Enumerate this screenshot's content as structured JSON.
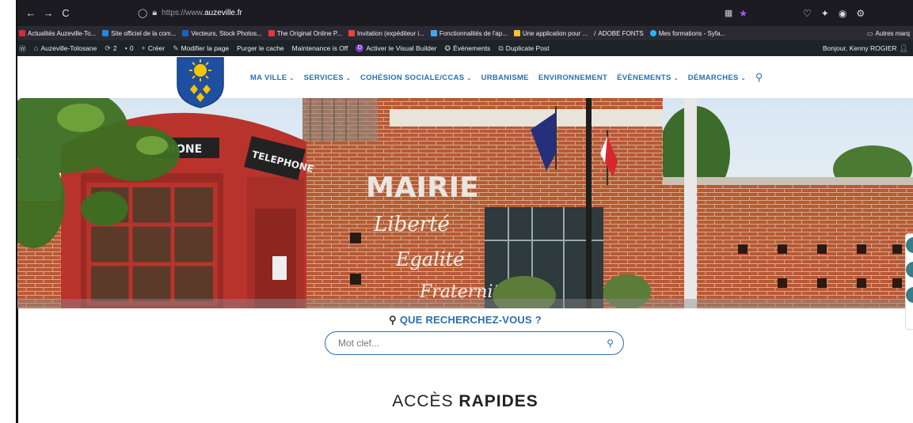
{
  "browser": {
    "back": "←",
    "forward": "→",
    "reload": "C",
    "url_prefix": "https://www.",
    "url_domain": "auzeville.fr"
  },
  "bookmarks": {
    "items": [
      {
        "label": "Actualités Auzeville-To...",
        "color": "#d32f2f"
      },
      {
        "label": "Site officiel de la com...",
        "color": "#1e88e5"
      },
      {
        "label": "Vecteurs, Stock Photos...",
        "color": "#1565c0"
      },
      {
        "label": "The Original Online P...",
        "color": "#e53935"
      },
      {
        "label": "Invitation (expéditeur i...",
        "color": "#ea4335"
      },
      {
        "label": "Fonctionnalités de l'ap...",
        "color": "#42a5f5"
      },
      {
        "label": "Une application pour ...",
        "color": "#fbc02d"
      },
      {
        "label": "ADOBE FONTS",
        "color": "#ffffff"
      },
      {
        "label": "Mes formations - Syfa...",
        "color": "#29b6f6"
      }
    ],
    "other": "Autres marq"
  },
  "wpbar": {
    "site_name": "Auzeville-Tolosane",
    "updates": "2",
    "comments": "0",
    "create": "Créer",
    "edit_page": "Modifier la page",
    "purge_cache": "Purger le cache",
    "maintenance": "Maintenance is Off",
    "visual_builder": "Activer le Visual Builder",
    "events": "Évènements",
    "duplicate": "Duplicate Post",
    "greeting": "Bonjour, Kenny ROGIER"
  },
  "menu": {
    "items": [
      {
        "label": "MA VILLE",
        "dropdown": true
      },
      {
        "label": "SERVICES",
        "dropdown": true
      },
      {
        "label": "COHÉSION SOCIALE/CCAS",
        "dropdown": true
      },
      {
        "label": "URBANISME",
        "dropdown": false
      },
      {
        "label": "ENVIRONNEMENT",
        "dropdown": false
      },
      {
        "label": "ÉVÈNEMENTS",
        "dropdown": true
      },
      {
        "label": "DÉMARCHES",
        "dropdown": true
      }
    ]
  },
  "hero": {
    "sign_mairie": "MAIRIE",
    "motto_1": "Liberté",
    "motto_2": "Egalité",
    "motto_3": "Fraternité",
    "booth_sign": "TELEPHONE",
    "booth_top": "PHONE"
  },
  "search": {
    "title": "QUE RECHERCHEZ-VOUS ?",
    "placeholder": "Mot clef..."
  },
  "acces": {
    "light": "ACCÈS",
    "bold": "RAPIDES"
  },
  "colors": {
    "brand_blue": "#2a6fb0",
    "brick": "#b5532f"
  }
}
